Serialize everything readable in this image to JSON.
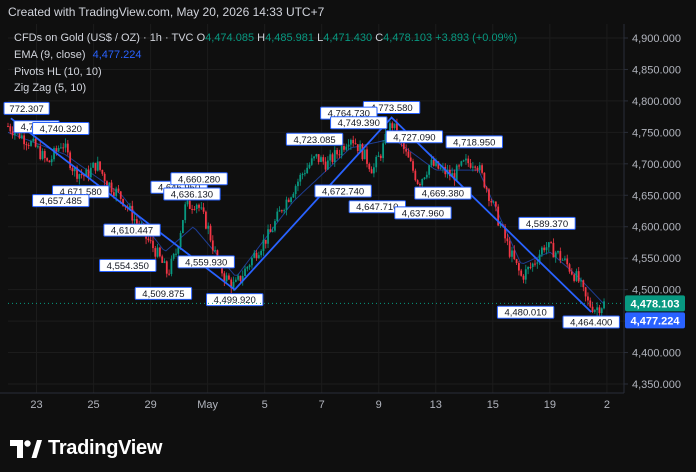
{
  "header": {
    "created": "Created with TradingView.com, May 20, 2026 14:33 UTC+7"
  },
  "legend": {
    "symbol": "CFDs on Gold (US$ / OZ) · 1h · TVC",
    "o_label": "O",
    "o_value": "4,474.085",
    "h_label": "H",
    "h_value": "4,485.981",
    "l_label": "L",
    "l_value": "4,471.430",
    "c_label": "C",
    "c_value": "4,478.103",
    "change": "+3.893 (+0.09%)",
    "ema_label": "EMA (9, close)",
    "ema_value": "4,477.224",
    "pivots_label": "Pivots HL (10, 10)",
    "zigzag_label": "Zig Zag (5, 10)"
  },
  "footer": {
    "brand": "TradingView"
  },
  "colors": {
    "up": "#089981",
    "down": "#f23645",
    "zigzag": "#2962ff",
    "ema": "#2962ff",
    "bg": "#0f0f0f",
    "grid": "#1c1c1c"
  },
  "chart_data": {
    "type": "candlestick",
    "y_range": [
      4350,
      4900
    ],
    "y_ticks": [
      4350,
      4400,
      4450,
      4500,
      4550,
      4600,
      4650,
      4700,
      4750,
      4800,
      4850,
      4900
    ],
    "x_ticks": [
      {
        "label": "23",
        "t": 1
      },
      {
        "label": "25",
        "t": 3
      },
      {
        "label": "29",
        "t": 5
      },
      {
        "label": "May",
        "t": 7
      },
      {
        "label": "5",
        "t": 9
      },
      {
        "label": "7",
        "t": 11
      },
      {
        "label": "9",
        "t": 13
      },
      {
        "label": "13",
        "t": 15
      },
      {
        "label": "15",
        "t": 17
      },
      {
        "label": "19",
        "t": 19
      },
      {
        "label": "2",
        "t": 21
      }
    ],
    "current_price": {
      "close": 4478.103,
      "ema": 4477.224,
      "close_label": "4,478.103",
      "ema_label": "4,477.224"
    },
    "zigzag": [
      {
        "t": 0.1,
        "price": 4772.307,
        "label": "772.307"
      },
      {
        "t": 7.95,
        "price": 4499.92,
        "label": "4,499.920"
      },
      {
        "t": 13.45,
        "price": 4773.58,
        "label": "4,773.580"
      },
      {
        "t": 20.45,
        "price": 4464.4,
        "label": "4,464.400"
      }
    ],
    "pivots": [
      {
        "t": 1.0,
        "price": 4743.1,
        "label": "4,743.1",
        "pos": "high"
      },
      {
        "t": 1.85,
        "price": 4740.32,
        "label": "4,740.320",
        "pos": "high"
      },
      {
        "t": 2.55,
        "price": 4671.58,
        "label": "4,671.580",
        "pos": "low"
      },
      {
        "t": 1.85,
        "price": 4657.485,
        "label": "4,657.485",
        "pos": "low"
      },
      {
        "t": 4.35,
        "price": 4610.447,
        "label": "4,610.447",
        "pos": "low"
      },
      {
        "t": 4.2,
        "price": 4554.35,
        "label": "4,554.350",
        "pos": "low"
      },
      {
        "t": 5.45,
        "price": 4509.875,
        "label": "4,509.875",
        "pos": "low"
      },
      {
        "t": 6.0,
        "price": 4646.95,
        "label": "4,646.950",
        "pos": "high"
      },
      {
        "t": 6.45,
        "price": 4636.13,
        "label": "4,636.130",
        "pos": "high"
      },
      {
        "t": 6.7,
        "price": 4660.28,
        "label": "4,660.280",
        "pos": "high"
      },
      {
        "t": 6.95,
        "price": 4559.93,
        "label": "4,559.930",
        "pos": "low"
      },
      {
        "t": 10.75,
        "price": 4723.085,
        "label": "4,723.085",
        "pos": "high"
      },
      {
        "t": 11.95,
        "price": 4764.73,
        "label": "4,764.730",
        "pos": "high"
      },
      {
        "t": 12.3,
        "price": 4749.39,
        "label": "4,749.390",
        "pos": "high"
      },
      {
        "t": 11.75,
        "price": 4672.74,
        "label": "4,672.740",
        "pos": "low"
      },
      {
        "t": 12.95,
        "price": 4647.71,
        "label": "4,647.710",
        "pos": "low"
      },
      {
        "t": 14.25,
        "price": 4727.09,
        "label": "4,727.090",
        "pos": "high"
      },
      {
        "t": 14.55,
        "price": 4637.96,
        "label": "4,637.960",
        "pos": "low"
      },
      {
        "t": 15.25,
        "price": 4669.38,
        "label": "4,669.380",
        "pos": "low"
      },
      {
        "t": 16.35,
        "price": 4718.95,
        "label": "4,718.950",
        "pos": "high"
      },
      {
        "t": 18.9,
        "price": 4589.37,
        "label": "4,589.370",
        "pos": "high"
      },
      {
        "t": 18.15,
        "price": 4480.01,
        "label": "4,480.010",
        "pos": "low"
      }
    ],
    "path_anchors": [
      [
        0.0,
        4760
      ],
      [
        0.6,
        4740
      ],
      [
        1.0,
        4725
      ],
      [
        1.4,
        4700
      ],
      [
        1.9,
        4735
      ],
      [
        2.3,
        4690
      ],
      [
        2.7,
        4680
      ],
      [
        3.1,
        4700
      ],
      [
        3.5,
        4670
      ],
      [
        4.0,
        4645
      ],
      [
        4.4,
        4615
      ],
      [
        4.8,
        4585
      ],
      [
        5.2,
        4560
      ],
      [
        5.6,
        4525
      ],
      [
        5.9,
        4560
      ],
      [
        6.2,
        4630
      ],
      [
        6.6,
        4640
      ],
      [
        7.0,
        4600
      ],
      [
        7.3,
        4550
      ],
      [
        7.6,
        4520
      ],
      [
        7.95,
        4505
      ],
      [
        8.3,
        4530
      ],
      [
        8.7,
        4560
      ],
      [
        9.2,
        4590
      ],
      [
        9.6,
        4630
      ],
      [
        10.0,
        4660
      ],
      [
        10.4,
        4690
      ],
      [
        10.8,
        4710
      ],
      [
        11.2,
        4700
      ],
      [
        11.6,
        4720
      ],
      [
        12.0,
        4745
      ],
      [
        12.4,
        4720
      ],
      [
        12.8,
        4690
      ],
      [
        13.1,
        4720
      ],
      [
        13.45,
        4765
      ],
      [
        13.8,
        4730
      ],
      [
        14.1,
        4700
      ],
      [
        14.4,
        4670
      ],
      [
        14.8,
        4700
      ],
      [
        15.2,
        4690
      ],
      [
        15.6,
        4680
      ],
      [
        16.0,
        4700
      ],
      [
        16.4,
        4705
      ],
      [
        16.8,
        4660
      ],
      [
        17.2,
        4610
      ],
      [
        17.6,
        4560
      ],
      [
        18.0,
        4520
      ],
      [
        18.4,
        4540
      ],
      [
        18.8,
        4570
      ],
      [
        19.2,
        4560
      ],
      [
        19.6,
        4540
      ],
      [
        20.0,
        4515
      ],
      [
        20.3,
        4480
      ],
      [
        20.6,
        4470
      ],
      [
        20.9,
        4478
      ]
    ],
    "ema_anchors": [
      [
        0.0,
        4750
      ],
      [
        2.0,
        4715
      ],
      [
        4.0,
        4650
      ],
      [
        5.5,
        4560
      ],
      [
        6.5,
        4600
      ],
      [
        8.0,
        4520
      ],
      [
        10.0,
        4640
      ],
      [
        12.0,
        4725
      ],
      [
        13.5,
        4740
      ],
      [
        15.0,
        4690
      ],
      [
        16.5,
        4690
      ],
      [
        18.0,
        4540
      ],
      [
        19.0,
        4560
      ],
      [
        20.0,
        4520
      ],
      [
        20.9,
        4477
      ]
    ]
  }
}
